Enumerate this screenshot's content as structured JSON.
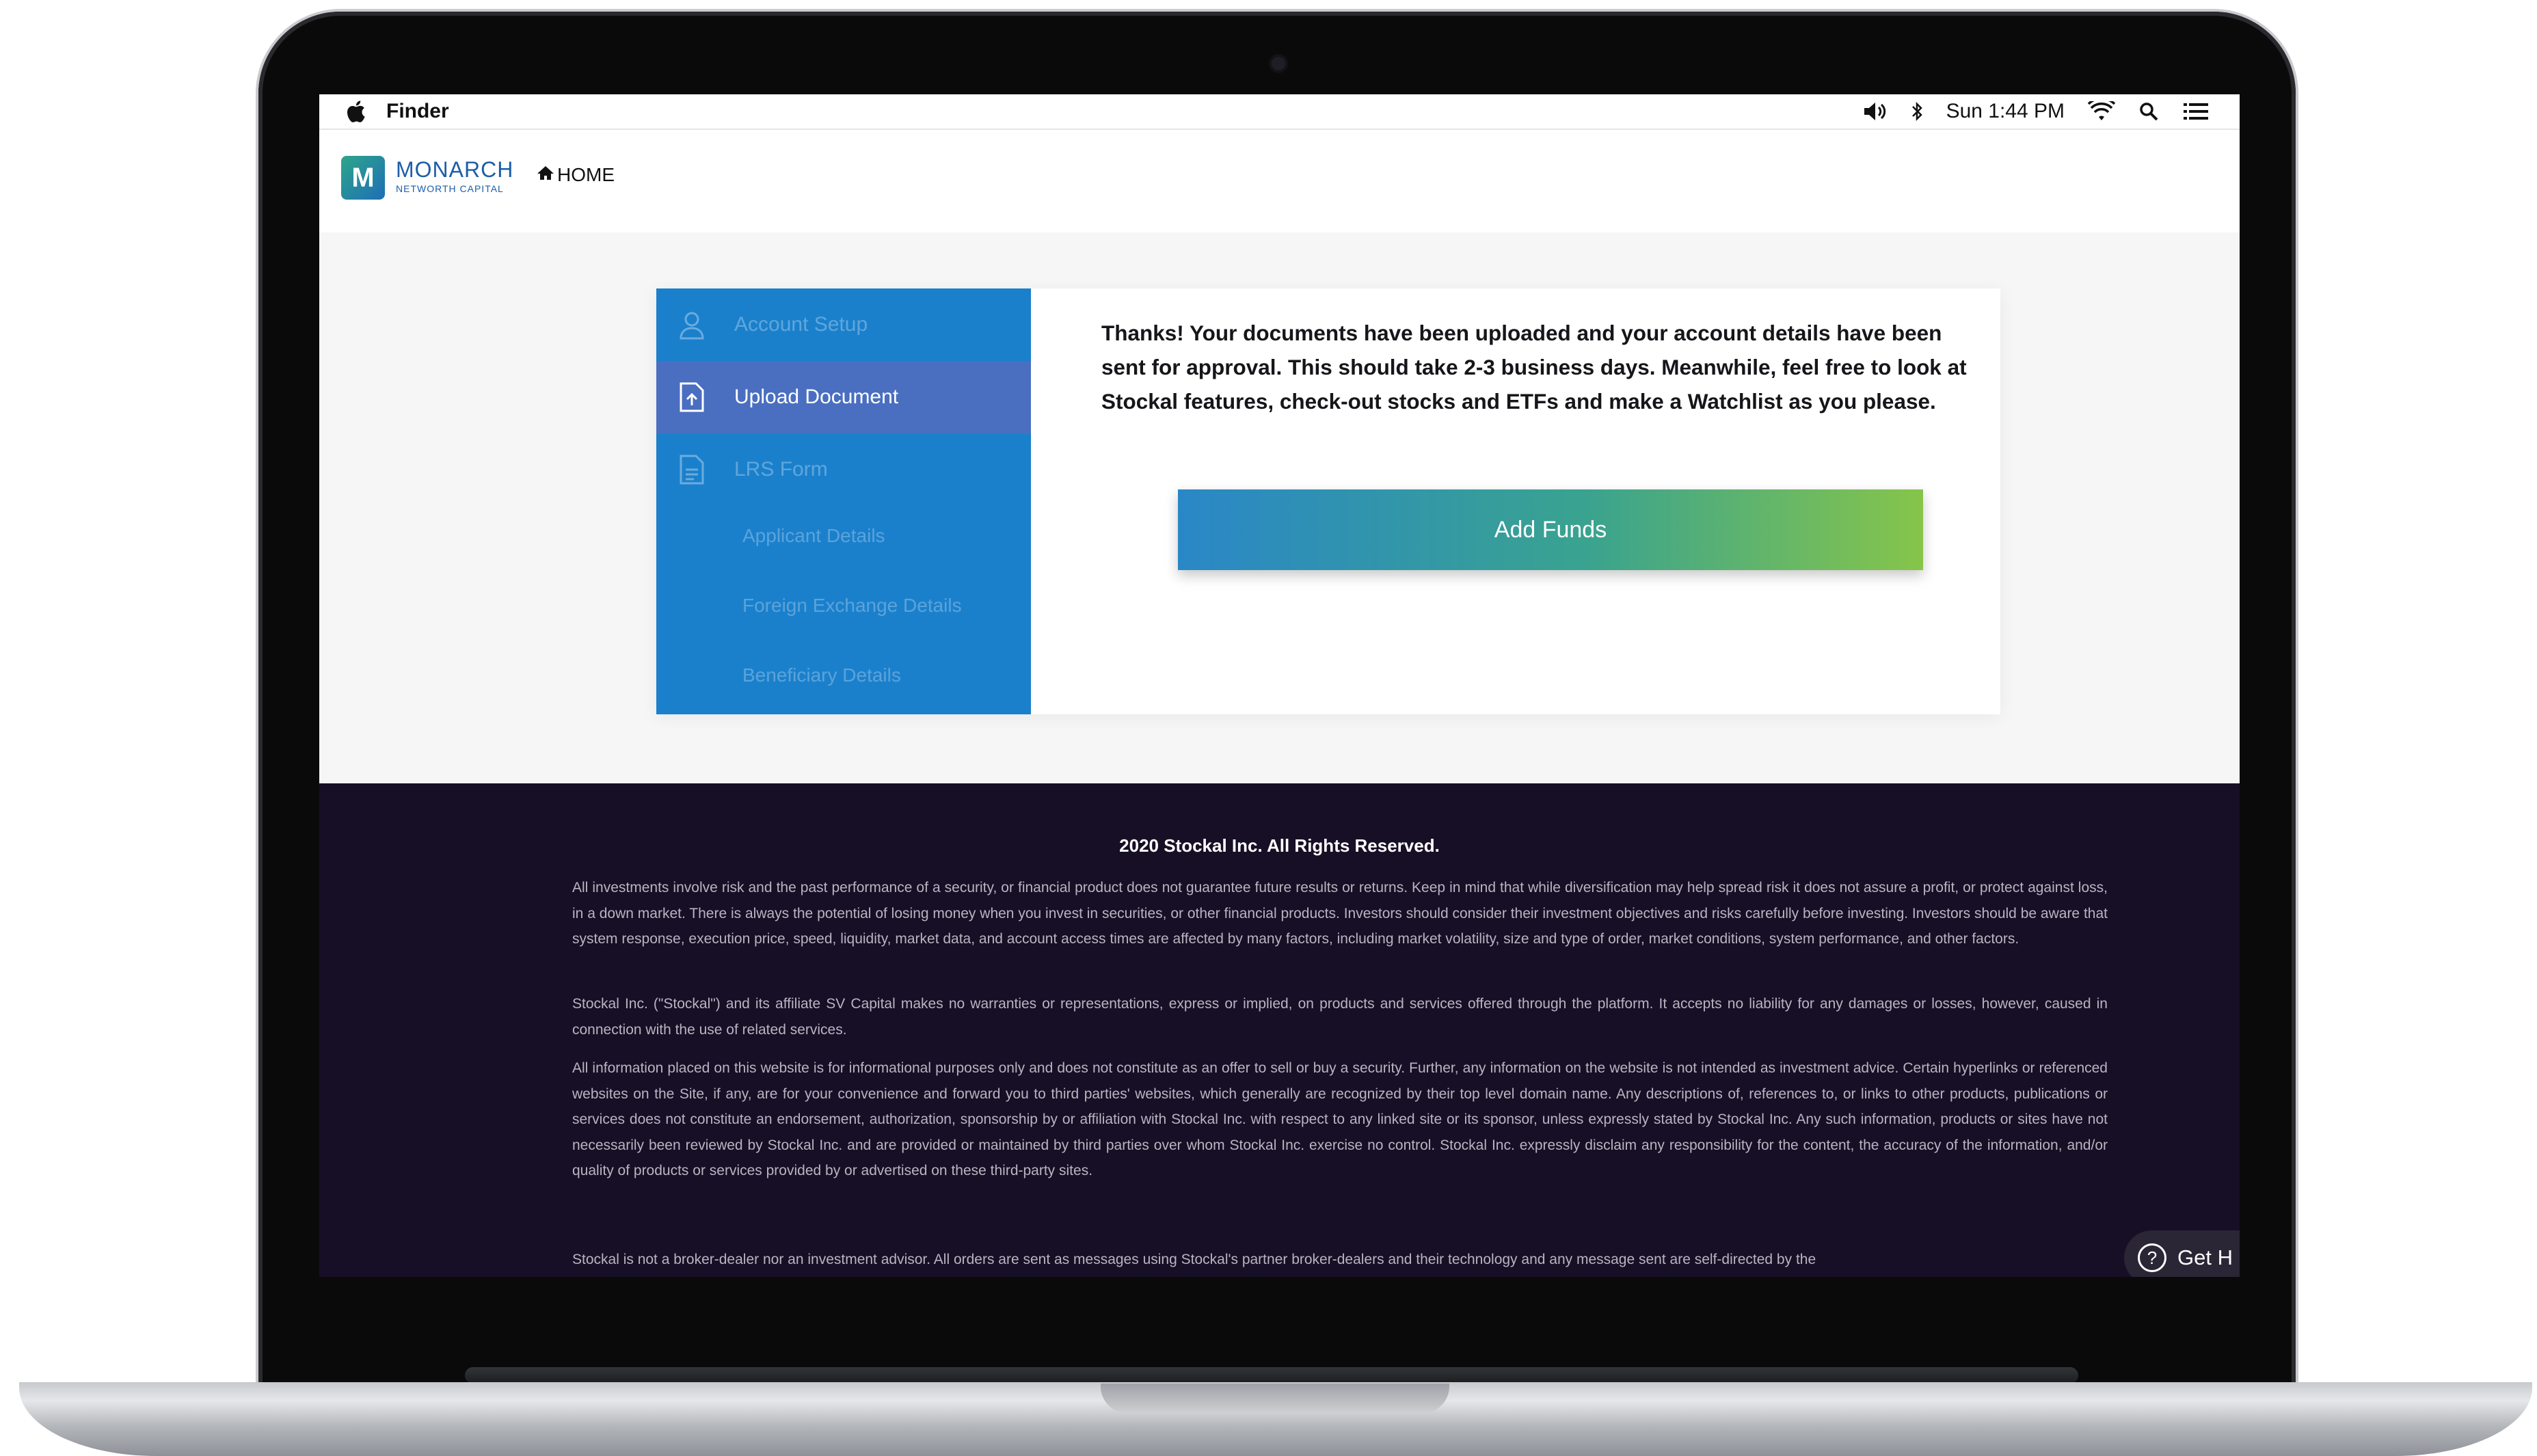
{
  "menubar": {
    "app_name": "Finder",
    "datetime": "Sun 1:44 PM",
    "icons": [
      "apple-icon",
      "volume-icon",
      "bluetooth-icon",
      "wifi-icon",
      "search-icon",
      "list-icon"
    ]
  },
  "header": {
    "logo_name": "MONARCH",
    "logo_sub": "NETWORTH CAPITAL",
    "logo_badge": "M",
    "home_label": "HOME"
  },
  "steps": [
    {
      "label": "Account Setup",
      "icon": "user-icon",
      "active": false
    },
    {
      "label": "Upload Document",
      "icon": "upload-doc-icon",
      "active": true
    },
    {
      "label": "LRS Form",
      "icon": "document-icon",
      "active": false
    }
  ],
  "substeps": [
    "Applicant Details",
    "Foreign Exchange Details",
    "Beneficiary Details"
  ],
  "main": {
    "message": "Thanks! Your documents have been uploaded and your account details have been sent for approval. This should take 2-3 business days. Meanwhile, feel free to look at Stockal features, check-out stocks and ETFs and make a Watchlist as you please.",
    "add_funds_label": "Add Funds"
  },
  "footer": {
    "copyright": "2020 Stockal Inc. All Rights Reserved.",
    "paragraphs": [
      "All investments involve risk and the past performance of a security, or financial product does not guarantee future results or returns. Keep in mind that while diversification may help spread risk it does not assure a profit, or protect against loss, in a down market. There is always the potential of losing money when you invest in securities, or other financial products. Investors should consider their investment objectives and risks carefully before investing. Investors should be aware that system response, execution price, speed, liquidity, market data, and account access times are affected by many factors, including market volatility, size and type of order, market conditions, system performance, and other factors.",
      "Stockal Inc. (\"Stockal\") and its affiliate SV Capital makes no warranties or representations, express or implied, on products and services offered through the platform. It accepts no liability for any damages or losses, however, caused in connection with the use of related services.",
      "All information placed on this website is for informational purposes only and does not constitute as an offer to sell or buy a security. Further, any information on the website is not intended as investment advice. Certain hyperlinks or referenced websites on the Site, if any, are for your convenience and forward you to third parties' websites, which generally are recognized by their top level domain name. Any descriptions of, references to, or links to other products, publications or services does not constitute an endorsement, authorization, sponsorship by or affiliation with Stockal Inc. with respect to any linked site or its sponsor, unless expressly stated by Stockal Inc. Any such information, products or sites have not necessarily been reviewed by Stockal Inc. and are provided or maintained by third parties over whom Stockal Inc. exercise no control. Stockal Inc. expressly disclaim any responsibility for the content, the accuracy of the information, and/or quality of products or services provided by or advertised on these third-party sites.",
      "Stockal is not a broker-dealer nor an investment advisor. All orders are sent as messages using Stockal's partner broker-dealers and their technology and any message sent are self-directed by the"
    ],
    "help_label": "Get H"
  },
  "colors": {
    "steps_bg": "#1b80cc",
    "step_active_bg": "#4a6fc0",
    "footer_bg": "#170f25",
    "button_gradient": [
      "#2a87c7",
      "#3aa38f",
      "#86c54a"
    ]
  }
}
